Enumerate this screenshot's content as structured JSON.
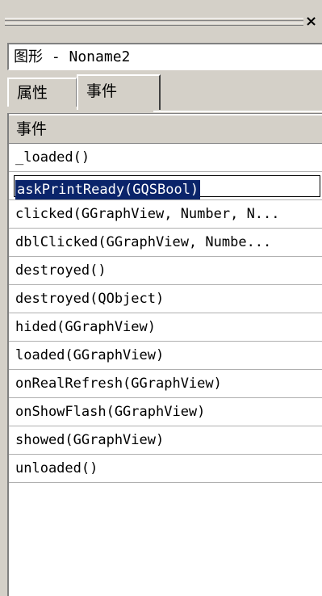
{
  "window": {
    "close_glyph": "×",
    "object_name": "图形 - Noname2"
  },
  "tabs": [
    {
      "label": "属性",
      "active": false
    },
    {
      "label": "事件",
      "active": true
    }
  ],
  "list": {
    "header": "事件",
    "selected_index": 1,
    "items": [
      "_loaded()",
      "askPrintReady(GQSBool)",
      "clicked(GGraphView, Number, N...",
      "dblClicked(GGraphView, Numbe...",
      "destroyed()",
      "destroyed(QObject)",
      "hided(GGraphView)",
      "loaded(GGraphView)",
      "onRealRefresh(GGraphView)",
      "onShowFlash(GGraphView)",
      "showed(GGraphView)",
      "unloaded()"
    ]
  },
  "colors": {
    "background": "#d4d0c8",
    "selection": "#0a246a"
  }
}
